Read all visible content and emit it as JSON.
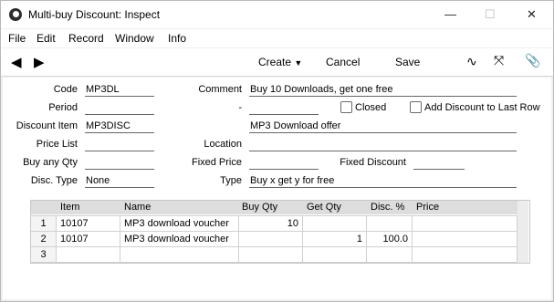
{
  "window": {
    "title": "Multi-buy Discount: Inspect"
  },
  "menu": [
    "File",
    "Edit",
    "Record",
    "Window",
    "Info"
  ],
  "toolbar": {
    "create": "Create",
    "cancel": "Cancel",
    "save": "Save"
  },
  "form": {
    "code_label": "Code",
    "code_value": "MP3DL",
    "comment_label": "Comment",
    "comment_value": "Buy 10 Downloads, get one free",
    "period_label": "Period",
    "period_value": "",
    "period_dash": "-",
    "period_end_value": "",
    "closed_label": "Closed",
    "add_discount_label": "Add Discount to Last Row",
    "discount_item_label": "Discount Item",
    "discount_item_value": "MP3DISC",
    "discount_item_desc": "MP3 Download offer",
    "price_list_label": "Price List",
    "price_list_value": "",
    "location_label": "Location",
    "location_value": "",
    "buy_any_qty_label": "Buy any Qty",
    "buy_any_qty_value": "",
    "fixed_price_label": "Fixed Price",
    "fixed_price_value": "",
    "fixed_discount_label": "Fixed Discount",
    "fixed_discount_value": "",
    "disc_type_label": "Disc. Type",
    "disc_type_value": "None",
    "type_label": "Type",
    "type_value": "Buy x get y for free"
  },
  "grid": {
    "headers": [
      "Item",
      "Name",
      "Buy Qty",
      "Get Qty",
      "Disc. %",
      "Price"
    ],
    "rows": [
      {
        "n": "1",
        "item": "10107",
        "name": "MP3 download voucher",
        "buy": "10",
        "get": "",
        "disc": "",
        "price": ""
      },
      {
        "n": "2",
        "item": "10107",
        "name": "MP3 download voucher",
        "buy": "",
        "get": "1",
        "disc": "100.0",
        "price": ""
      },
      {
        "n": "3",
        "item": "",
        "name": "",
        "buy": "",
        "get": "",
        "disc": "",
        "price": ""
      }
    ]
  }
}
